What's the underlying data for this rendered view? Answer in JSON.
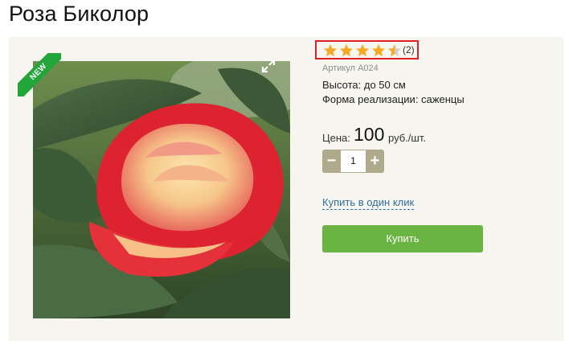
{
  "product": {
    "title": "Роза Биколор",
    "badge": "NEW",
    "image_alt": "rose-bicolor-photo",
    "rating": {
      "value": 4.5,
      "max": 5,
      "count_label": "(2)",
      "star_color": "#f7a823",
      "star_empty_color": "#cfcfcf",
      "highlight_color": "#e01f26"
    },
    "sku": "Артикул A024",
    "attributes": {
      "height": "Высота: до 50 см",
      "form": "Форма реализации: саженцы"
    },
    "price": {
      "label": "Цена:",
      "value": "100",
      "unit": "руб./шт."
    },
    "quantity": {
      "minus": "−",
      "value": "1",
      "plus": "+"
    },
    "one_click_label": "Купить в один клик",
    "buy_label": "Купить",
    "colors": {
      "buy": "#6bb443",
      "badge": "#22a539",
      "panel": "#f7f5ef",
      "link": "#2f6f9f"
    }
  }
}
